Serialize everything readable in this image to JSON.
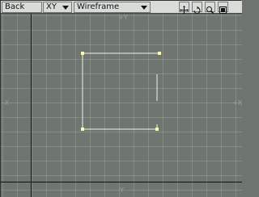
{
  "toolbar": {
    "view_label": "Back",
    "axis_label": "XY",
    "mode_label": "Wireframe",
    "icons": [
      "move-icon",
      "rotate-icon",
      "zoom-icon",
      "maximize-icon"
    ]
  },
  "viewport": {
    "top_label": "+Y",
    "bottom_label": "-Y",
    "left_label": "-X",
    "right_label": "+X"
  },
  "colors": {
    "background": "#6f756f",
    "grid": "#9aa09a",
    "axis": "#111111",
    "wireframe": "#f2f2f2",
    "vertex": "#fff7b3"
  }
}
